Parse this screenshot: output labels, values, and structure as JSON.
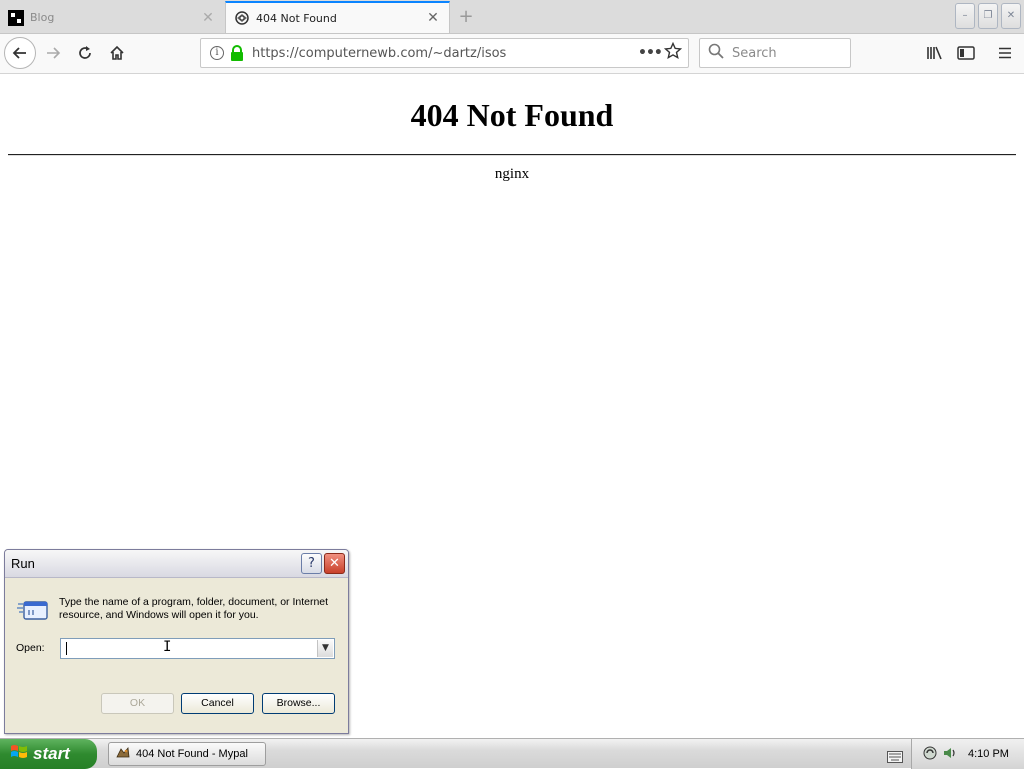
{
  "browser": {
    "tabs": [
      {
        "title": "Blog",
        "favicon": "blog-favicon",
        "active": false
      },
      {
        "title": "404 Not Found",
        "favicon": "mypal-favicon",
        "active": true
      }
    ],
    "new_tab_glyph": "+",
    "close_glyph": "✕",
    "window_controls": {
      "minimize": "–",
      "restore": "❐",
      "close": "✕"
    },
    "url": "https://computernewb.com/~dartz/isos",
    "page_actions_glyph": "•••",
    "search_placeholder": "Search",
    "icons": [
      "back-icon",
      "forward-icon",
      "reload-icon",
      "home-icon",
      "info-icon",
      "lock-icon",
      "bookmark-star-icon",
      "search-icon",
      "library-icon",
      "sidebar-icon",
      "menu-icon"
    ]
  },
  "page": {
    "heading": "404 Not Found",
    "server": "nginx"
  },
  "run_dialog": {
    "title": "Run",
    "help_glyph": "?",
    "close_glyph": "✕",
    "description": "Type the name of a program, folder, document, or Internet resource, and Windows will open it for you.",
    "open_label": "Open:",
    "open_value": "",
    "ok_label": "OK",
    "cancel_label": "Cancel",
    "browse_label": "Browse..."
  },
  "taskbar": {
    "start_label": "start",
    "task_label": "404 Not Found - Mypal",
    "clock": "4:10 PM"
  },
  "colors": {
    "tab_accent": "#0a84ff",
    "lock_green": "#12bc00",
    "start_green": "#2f8a2f"
  }
}
